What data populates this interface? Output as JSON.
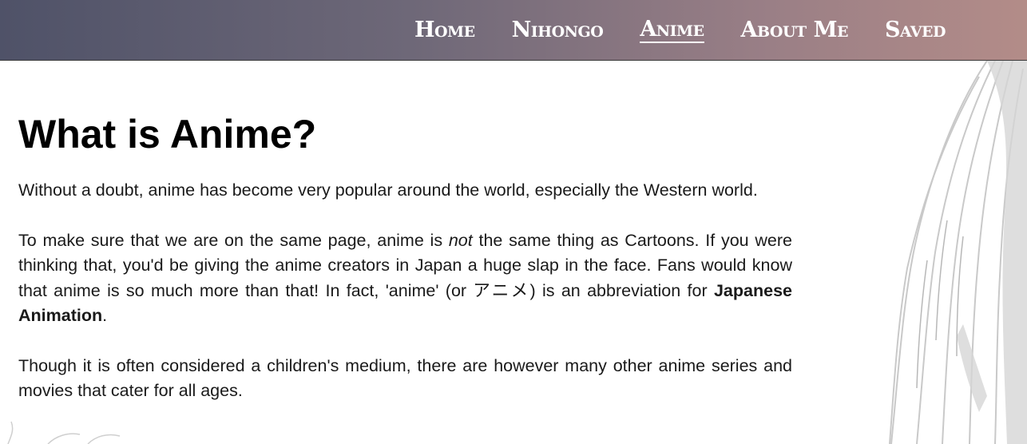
{
  "nav": {
    "items": [
      {
        "label": "Home",
        "active": false
      },
      {
        "label": "Nihongo",
        "active": false
      },
      {
        "label": "Anime",
        "active": true
      },
      {
        "label": "About Me",
        "active": false
      },
      {
        "label": "Saved",
        "active": false
      }
    ]
  },
  "main": {
    "title": "What is Anime?",
    "paragraph1": "Without a doubt, anime has become very popular around the world, especially the Western world.",
    "paragraph2": {
      "part1": "To make sure that we are on the same page, anime is ",
      "emphasis": "not",
      "part2": " the same thing as Cartoons. If you were thinking that, you'd be giving the anime creators in Japan a huge slap in the face. Fans would know that anime is so much more than that! In fact, 'anime' (or ",
      "japanese": "アニメ",
      "part3": ") is an abbreviation for ",
      "bold": "Japanese Animation",
      "part4": "."
    },
    "paragraph3": "Though it is often considered a children's medium, there are however many other anime series and movies that cater for all ages."
  },
  "colors": {
    "nav_gradient_start": "#4f5268",
    "nav_gradient_end": "#b38c88",
    "text": "#1a1a1a",
    "background": "#ffffff"
  }
}
